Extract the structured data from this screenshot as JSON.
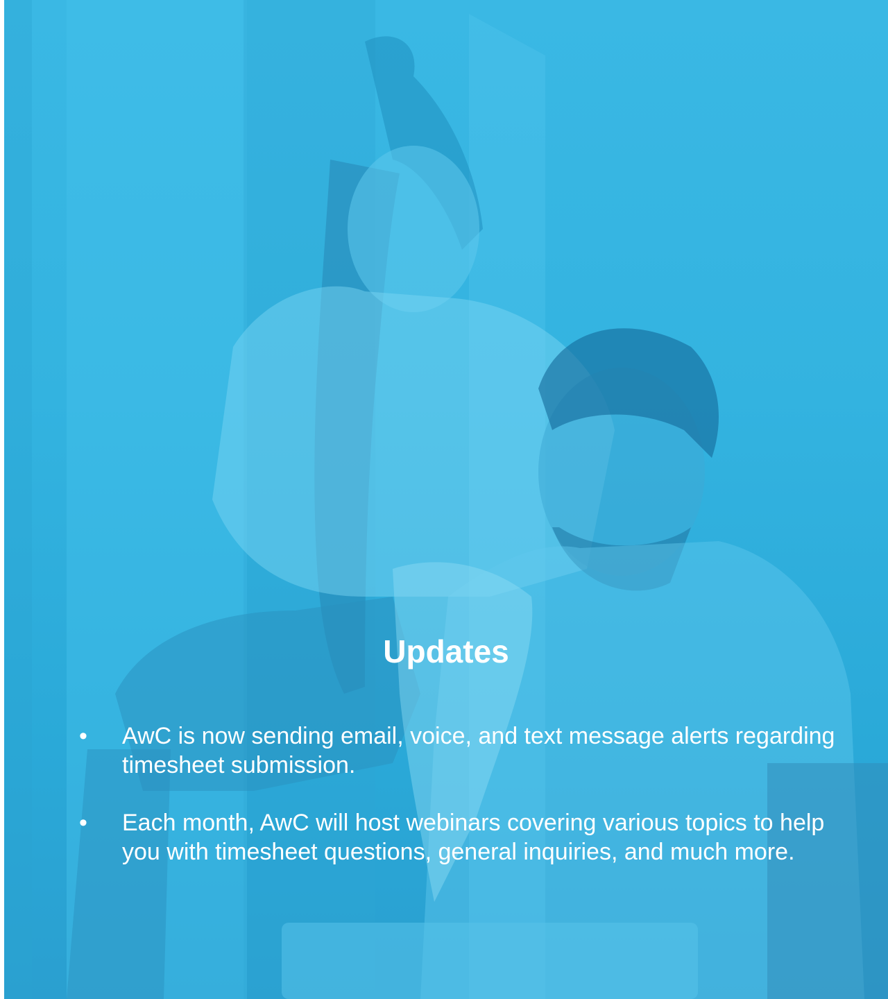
{
  "slide": {
    "title": "Updates",
    "bullet_glyph": "•",
    "bullets": [
      {
        "text": "AwC is now sending email, voice, and text message alerts regarding timesheet submission."
      },
      {
        "text": "Each month, AwC will host webinars covering various topics to help you with timesheet questions, general inquiries, and much more."
      }
    ]
  },
  "colors": {
    "overlay": "#33b3e0",
    "text": "#ffffff"
  },
  "background_image": "photo of two people looking at a laptop with blue tint"
}
